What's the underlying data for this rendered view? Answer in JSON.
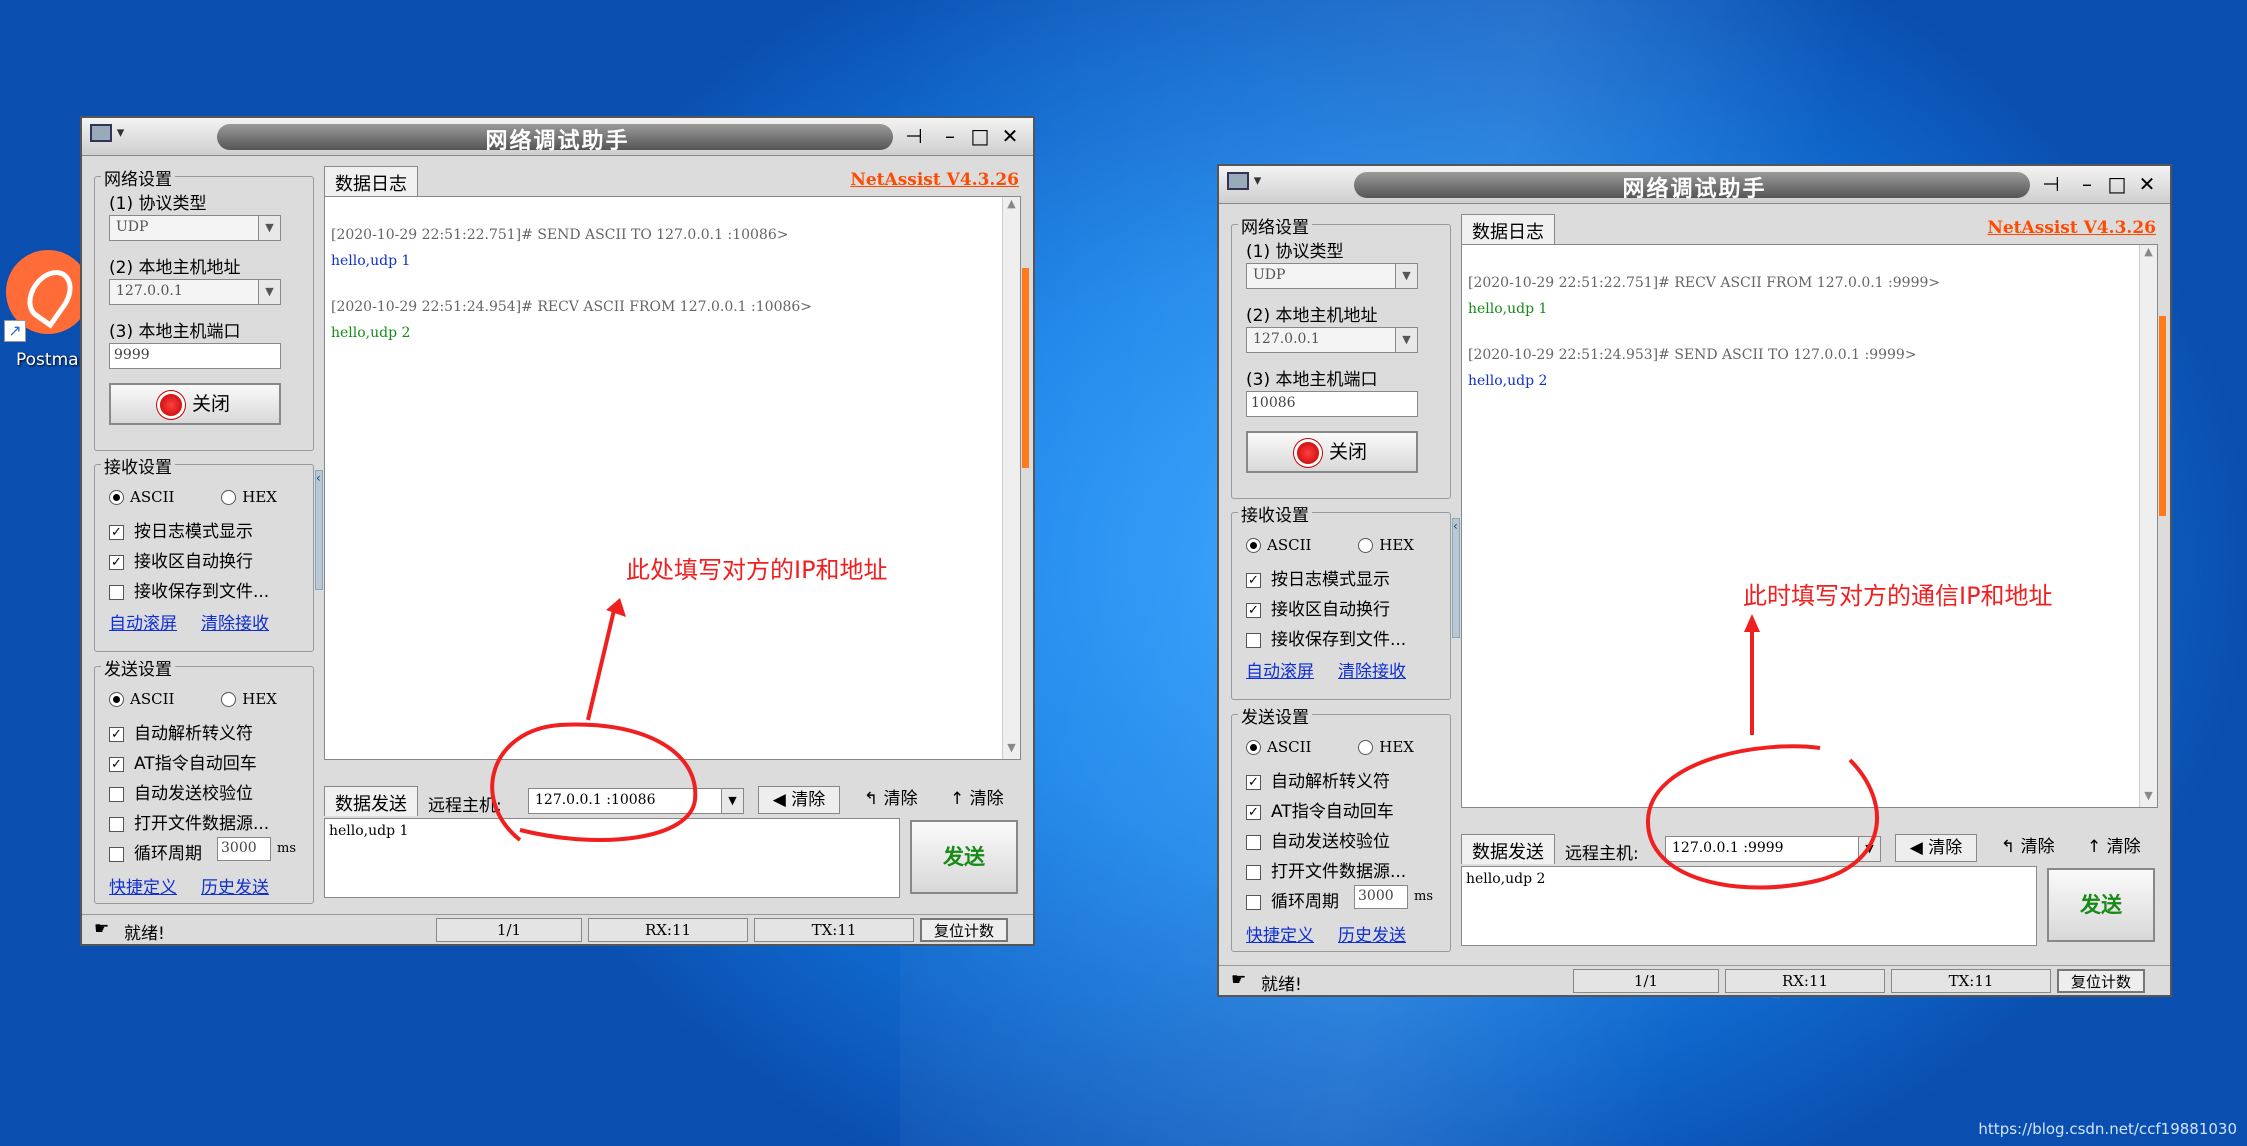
{
  "desktop": {
    "icon_label": "Postman",
    "watermark": "https://blog.csdn.net/ccf19881030"
  },
  "app": {
    "title": "网络调试助手",
    "version": "NetAssist V4.3.26",
    "net_group": "网络设置",
    "proto_label": "(1) 协议类型",
    "host_label": "(2) 本地主机地址",
    "port_label": "(3) 本地主机端口",
    "close_btn": "关闭",
    "recv_group": "接收设置",
    "ascii": "ASCII",
    "hex": "HEX",
    "recv_opt1": "按日志模式显示",
    "recv_opt2": "接收区自动换行",
    "recv_opt3": "接收保存到文件...",
    "auto_scroll": "自动滚屏",
    "clear_recv": "清除接收",
    "send_group": "发送设置",
    "send_opt1": "自动解析转义符",
    "send_opt2": "AT指令自动回车",
    "send_opt3": "自动发送校验位",
    "send_opt4": "打开文件数据源...",
    "send_opt5": "循环周期",
    "ms": "ms",
    "quick_def": "快捷定义",
    "history": "历史发送",
    "log_tab": "数据日志",
    "send_tab": "数据发送",
    "remote_label": "远程主机:",
    "clear": "清除",
    "send_btn": "发送",
    "status_ready": "就绪!",
    "rx": "RX:11",
    "tx": "TX:11",
    "reset_count": "复位计数",
    "page": "1/1"
  },
  "win1": {
    "protocol": "UDP",
    "host": "127.0.0.1",
    "port": "9999",
    "period": "3000",
    "remote": "127.0.0.1 :10086",
    "log": [
      {
        "text": "[2020-10-29 22:51:22.751]# SEND ASCII TO 127.0.0.1 :10086>",
        "cls": "hdr"
      },
      {
        "text": "hello,udp 1",
        "cls": "blue"
      },
      {
        "text": "[2020-10-29 22:51:24.954]# RECV ASCII FROM 127.0.0.1 :10086>",
        "cls": "hdr"
      },
      {
        "text": "hello,udp 2",
        "cls": "green"
      }
    ],
    "send_text": "hello,udp 1",
    "annotation": "此处填写对方的IP和地址"
  },
  "win2": {
    "protocol": "UDP",
    "host": "127.0.0.1",
    "port": "10086",
    "period": "3000",
    "remote": "127.0.0.1 :9999",
    "log": [
      {
        "text": "[2020-10-29 22:51:22.751]# RECV ASCII FROM 127.0.0.1 :9999>",
        "cls": "hdr"
      },
      {
        "text": "hello,udp 1",
        "cls": "green"
      },
      {
        "text": "[2020-10-29 22:51:24.953]# SEND ASCII TO 127.0.0.1 :9999>",
        "cls": "hdr"
      },
      {
        "text": "hello,udp 2",
        "cls": "blue"
      }
    ],
    "send_text": "hello,udp 2",
    "annotation": "此时填写对方的通信IP和地址"
  },
  "colors": {
    "annotation": "#f02020",
    "version": "#ff4a00",
    "send_green": "#188a18",
    "link_blue": "#1030d0"
  }
}
